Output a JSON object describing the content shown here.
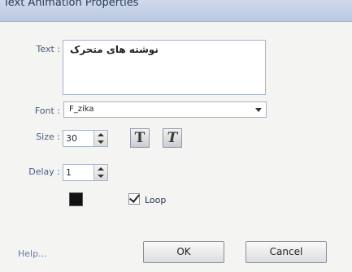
{
  "window": {
    "title": "Text Animation Properties"
  },
  "form": {
    "text_label": "Text :",
    "text_value": "نوشته های متحرک",
    "font_label": "Font :",
    "font_value": "F_zika",
    "size_label": "Size :",
    "size_value": "30",
    "delay_label": "Delay :",
    "delay_value": "1",
    "bold_glyph": "T",
    "italic_glyph": "T",
    "color_value": "#111111",
    "loop_label": "Loop",
    "loop_checked": true
  },
  "footer": {
    "help_label": "Help...",
    "ok_label": "OK",
    "cancel_label": "Cancel"
  },
  "icons": [
    "dropdown-arrow-icon",
    "spin-up-icon",
    "spin-down-icon",
    "bold-icon",
    "italic-icon",
    "checkmark-icon"
  ]
}
